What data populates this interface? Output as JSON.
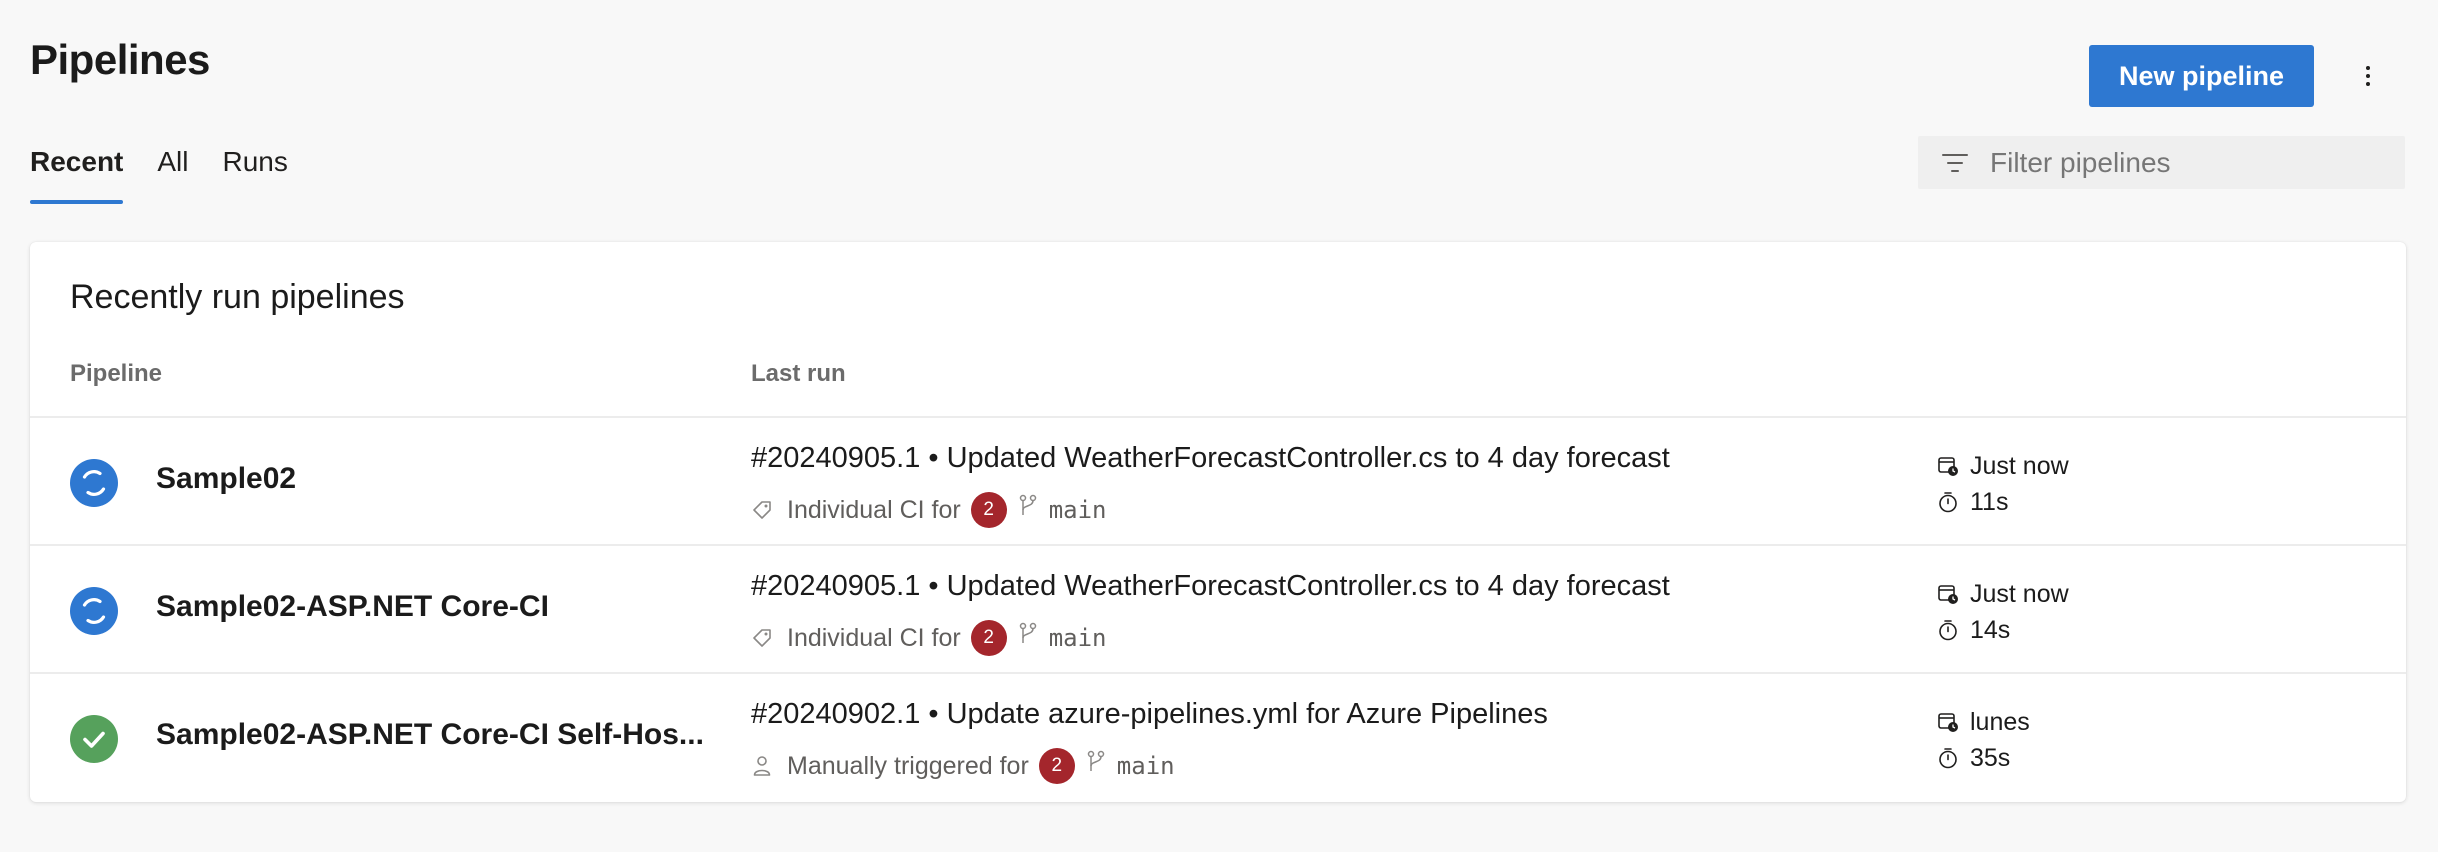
{
  "header": {
    "title": "Pipelines",
    "new_button": "New pipeline",
    "more_icon": "more-vertical-icon"
  },
  "tabs": [
    {
      "label": "Recent",
      "active": true
    },
    {
      "label": "All",
      "active": false
    },
    {
      "label": "Runs",
      "active": false
    }
  ],
  "filter": {
    "placeholder": "Filter pipelines",
    "value": "",
    "icon": "filter-icon"
  },
  "card": {
    "title": "Recently run pipelines",
    "columns": {
      "pipeline": "Pipeline",
      "last_run": "Last run"
    },
    "rows": [
      {
        "status": "in-progress",
        "name": "Sample02",
        "run_title": "#20240905.1 • Updated WeatherForecastController.cs to 4 day forecast",
        "trigger": "Individual CI for",
        "trigger_icon": "tag-icon",
        "badge": "2",
        "branch": "main",
        "when": "Just now",
        "duration": "11s"
      },
      {
        "status": "in-progress",
        "name": "Sample02-ASP.NET Core-CI",
        "run_title": "#20240905.1 • Updated WeatherForecastController.cs to 4 day forecast",
        "trigger": "Individual CI for",
        "trigger_icon": "tag-icon",
        "badge": "2",
        "branch": "main",
        "when": "Just now",
        "duration": "14s"
      },
      {
        "status": "succeeded",
        "name": "Sample02-ASP.NET Core-CI Self-Hos...",
        "run_title": "#20240902.1 • Update azure-pipelines.yml for Azure Pipelines",
        "trigger": "Manually triggered for",
        "trigger_icon": "person-icon",
        "badge": "2",
        "branch": "main",
        "when": "lunes",
        "duration": "35s"
      }
    ]
  },
  "colors": {
    "accent": "#2e78d1",
    "in_progress": "#2e78d1",
    "succeeded": "#56a15c",
    "badge": "#a4262c",
    "background": "#f8f8f8"
  }
}
